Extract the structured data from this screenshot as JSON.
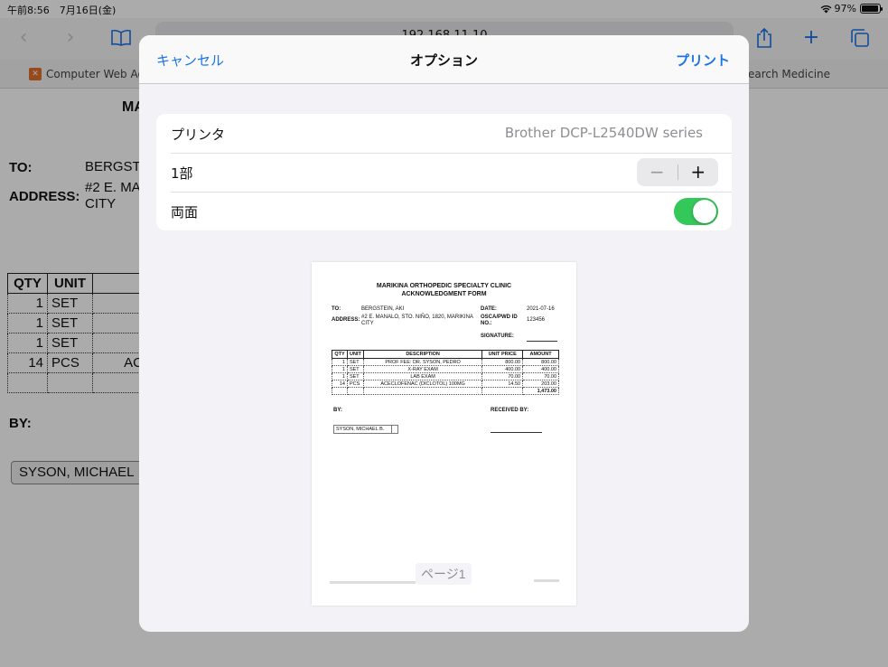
{
  "status_bar": {
    "time": "午前8:56　7月16日(金)",
    "battery": "97%",
    "battery_level": 0.97
  },
  "browser": {
    "address": "192.168.11.10",
    "bookmarks": [
      {
        "label": "Computer Web Ad"
      },
      {
        "label": "earch Medicine"
      }
    ]
  },
  "background_doc": {
    "title_fragment": "MA",
    "to_label": "TO:",
    "to_value": "BERGST",
    "address_label": "ADDRESS:",
    "address_line1": "#2 E. MA",
    "address_line2": "CITY",
    "table_headers": [
      "QTY",
      "UNIT"
    ],
    "table_rows": [
      {
        "qty": "1",
        "unit": "SET",
        "desc": ""
      },
      {
        "qty": "1",
        "unit": "SET",
        "desc": ""
      },
      {
        "qty": "1",
        "unit": "SET",
        "desc": ""
      },
      {
        "qty": "14",
        "unit": "PCS",
        "desc": "AC"
      }
    ],
    "by_label": "BY:",
    "signer": "SYSON, MICHAEL"
  },
  "dialog": {
    "cancel_label": "キャンセル",
    "title": "オプション",
    "print_label": "プリント",
    "printer_label": "プリンタ",
    "printer_value": "Brother DCP-L2540DW series",
    "copies_label": "1部",
    "stepper_minus": "−",
    "stepper_plus": "+",
    "duplex_label": "両面",
    "duplex_on": true,
    "page_label": "ページ1"
  },
  "preview": {
    "title_line1": "MARIKINA ORTHOPEDIC SPECIALTY CLINIC",
    "title_line2": "ACKNOWLEDGMENT FORM",
    "to_label": "TO:",
    "to_value": "BERGSTEIN, AKI",
    "address_label": "ADDRESS:",
    "address_value_line1": "#2 E. MANALO, STO. NIÑO, 1820, MARIKINA",
    "address_value_line2": "CITY",
    "date_label": "DATE:",
    "date_value": "2021-07-16",
    "osca_label_line1": "OSCA/PWD ID",
    "osca_label_line2": "NO.:",
    "osca_value": "123456",
    "signature_label": "SIGNATURE:",
    "table_headers": [
      "QTY",
      "UNIT",
      "DESCRIPTION",
      "UNIT PRICE",
      "AMOUNT"
    ],
    "table_rows": [
      {
        "qty": "1",
        "unit": "SET",
        "desc": "PROF FEE: DR. SYSON, PEDRO",
        "price": "800.00",
        "amount": "800.00"
      },
      {
        "qty": "1",
        "unit": "SET",
        "desc": "X-RAY EXAM",
        "price": "400.00",
        "amount": "400.00"
      },
      {
        "qty": "1",
        "unit": "SET",
        "desc": "LAB EXAM",
        "price": "70.00",
        "amount": "70.00"
      },
      {
        "qty": "14",
        "unit": "PCS",
        "desc": "ACECLOFENAC (DICLOTOL) 100MG",
        "price": "14.50",
        "amount": "203.00"
      }
    ],
    "total": "1,473.00",
    "by_label": "BY:",
    "received_label": "RECEIVED BY:",
    "signer": "SYSON, MICHAEL B."
  }
}
